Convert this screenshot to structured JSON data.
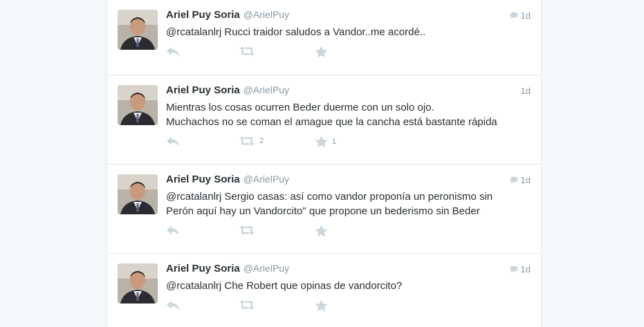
{
  "tweets": [
    {
      "name": "Ariel Puy Soria",
      "handle": "@ArielPuy",
      "time": "1d",
      "conversation": true,
      "text": "@rcatalanlrj Rucci traidor saludos a Vandor..me acordé..",
      "retweets": "",
      "favorites": ""
    },
    {
      "name": "Ariel Puy Soria",
      "handle": "@ArielPuy",
      "time": "1d",
      "conversation": false,
      "text": "Mientras los cosas ocurren Beder duerme con un solo ojo.\nMuchachos no se coman el amague que la cancha está bastante rápida",
      "retweets": "2",
      "favorites": "1"
    },
    {
      "name": "Ariel Puy Soria",
      "handle": "@ArielPuy",
      "time": "1d",
      "conversation": true,
      "text": "@rcatalanlrj Sergio casas: así como vandor proponía un peronismo sin\nPerón aquí hay  un Vandorcito\" que propone un bederismo sin Beder",
      "retweets": "",
      "favorites": ""
    },
    {
      "name": "Ariel Puy Soria",
      "handle": "@ArielPuy",
      "time": "1d",
      "conversation": true,
      "text": "@rcatalanlrj Che Robert que opinas de vandorcito?",
      "retweets": "",
      "favorites": ""
    }
  ],
  "icons": {
    "reply": "reply-icon",
    "retweet": "retweet-icon",
    "favorite": "star-icon",
    "conversation": "speech-bubble-icon"
  },
  "colors": {
    "text": "#292f33",
    "muted": "#8899a6",
    "icon": "#ccd6dd",
    "border": "#e1e8ed",
    "background": "#f5f8fa"
  }
}
